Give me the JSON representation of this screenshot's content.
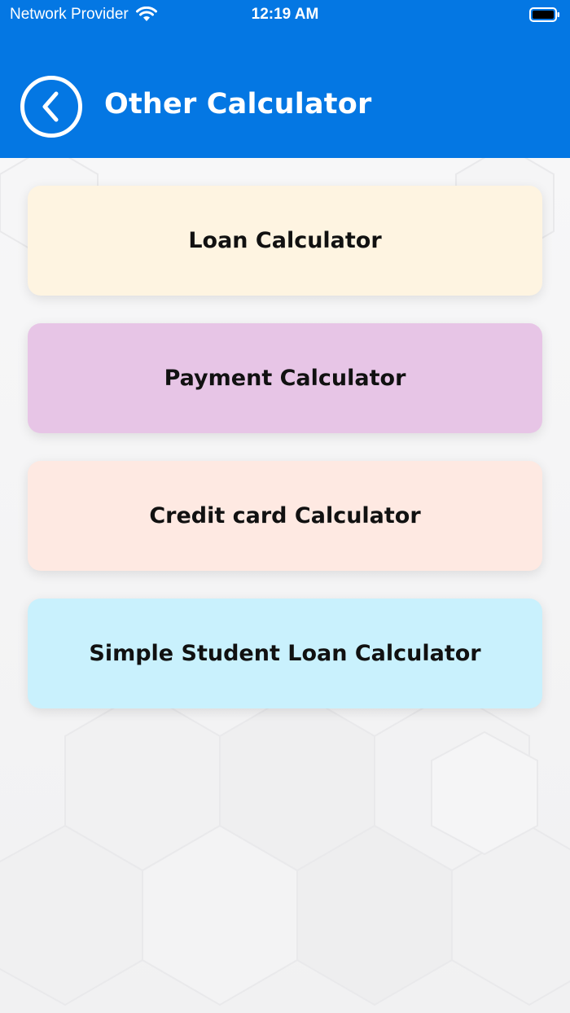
{
  "status_bar": {
    "carrier": "Network Provider",
    "time": "12:19 AM"
  },
  "header": {
    "title": "Other Calculator",
    "background_color": "#0477e3",
    "back_icon": "chevron-left-icon"
  },
  "menu": {
    "items": [
      {
        "label": "Loan Calculator",
        "color": "#fef4e1"
      },
      {
        "label": "Payment Calculator",
        "color": "#e7c5e6"
      },
      {
        "label": "Credit card Calculator",
        "color": "#fee9e2"
      },
      {
        "label": "Simple Student Loan Calculator",
        "color": "#c9f1fd"
      }
    ]
  }
}
